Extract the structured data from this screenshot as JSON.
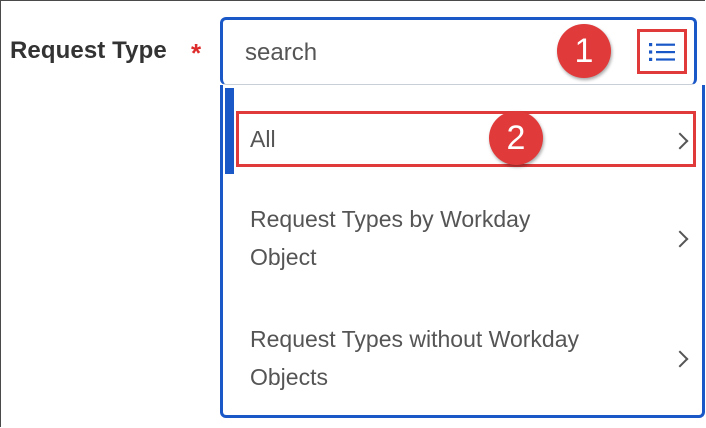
{
  "form": {
    "label": "Request Type",
    "required_mark": "*",
    "search_placeholder": "search",
    "list_icon": "list-icon"
  },
  "annotations": {
    "marker_1": "1",
    "marker_2": "2"
  },
  "dropdown": {
    "items": [
      {
        "lines": [
          "All"
        ]
      },
      {
        "lines": [
          "Request Types by Workday",
          "Object"
        ]
      },
      {
        "lines": [
          "Request Types without Workday",
          "Objects"
        ]
      }
    ]
  },
  "colors": {
    "accent": "#1a58c7",
    "annotation": "#e03a3a",
    "required": "#de2b2b"
  }
}
